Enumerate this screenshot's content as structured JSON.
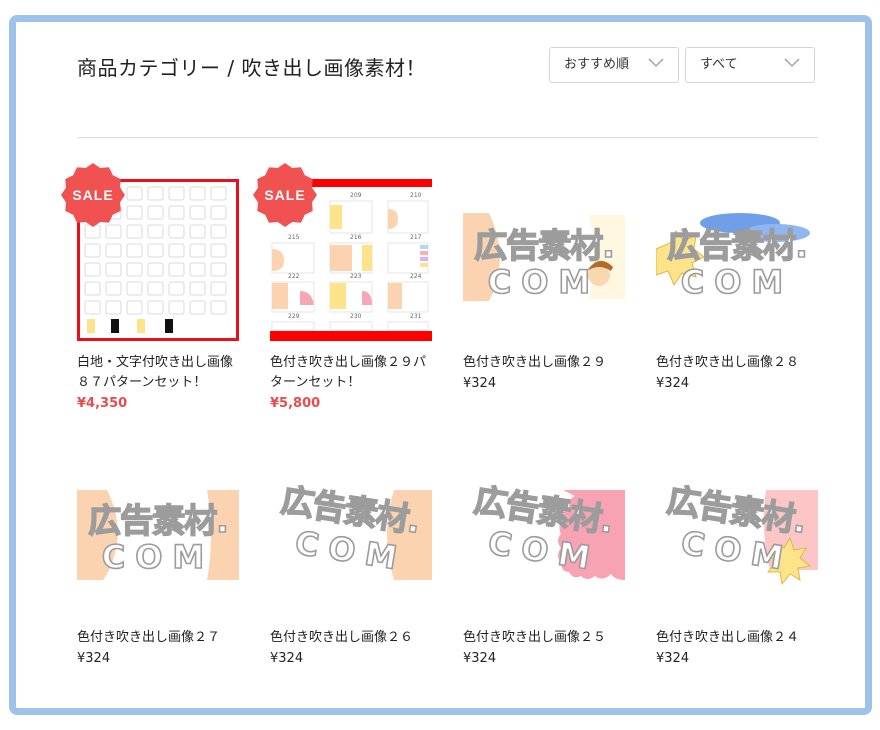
{
  "header": {
    "title": "商品カテゴリー / 吹き出し画像素材！",
    "sort_select": "おすすめ順",
    "filter_select": "すべて"
  },
  "colors": {
    "sale": "#e94c4c",
    "frame": "#9ec2ea"
  },
  "watermark": {
    "line1": "広告素材.",
    "line2": "COM"
  },
  "products": [
    {
      "name": "白地・文字付吹き出し画像８７パターンセット！",
      "price": "¥4,350",
      "badge": "SALE"
    },
    {
      "name": "色付き吹き出し画像２９パターンセット！",
      "price": "¥5,800",
      "badge": "SALE",
      "sheet_numbers": [
        "209",
        "210",
        "215",
        "216",
        "217",
        "222",
        "223",
        "224",
        "229",
        "230",
        "231"
      ]
    },
    {
      "name": "色付き吹き出し画像２９",
      "price": "¥324"
    },
    {
      "name": "色付き吹き出し画像２８",
      "price": "¥324"
    },
    {
      "name": "色付き吹き出し画像２７",
      "price": "¥324"
    },
    {
      "name": "色付き吹き出し画像２６",
      "price": "¥324"
    },
    {
      "name": "色付き吹き出し画像２５",
      "price": "¥324"
    },
    {
      "name": "色付き吹き出し画像２４",
      "price": "¥324"
    }
  ]
}
